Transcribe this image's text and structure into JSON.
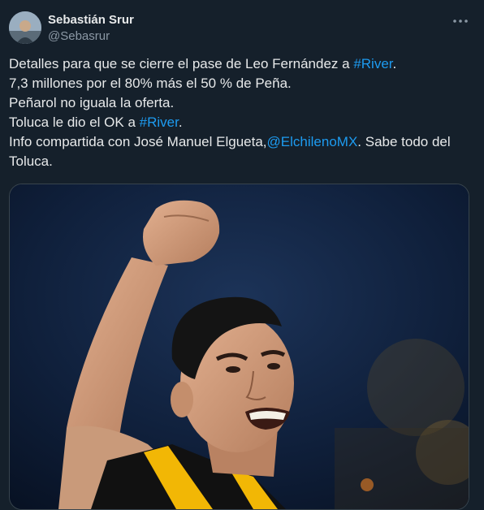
{
  "author": {
    "display_name": "Sebastián Srur",
    "handle": "@Sebasrur"
  },
  "icons": {
    "more": "more-dots-icon",
    "avatar": "avatar"
  },
  "tweet": {
    "line1_text": "Detalles para que se cierre el pase de Leo Fernández a ",
    "line1_hashtag": "#River",
    "line1_end": ".",
    "line2": "7,3 millones por el 80% más el 50 % de Peña.",
    "line3": "Peñarol no iguala la oferta.",
    "line4_text": "Toluca le dio el OK a ",
    "line4_hashtag": "#River",
    "line4_end": ".",
    "line5_text": "Info compartida con José Manuel Elgueta,",
    "line5_mention": "@ElchilenoMX",
    "line5_end": ". Sabe todo del",
    "line6": "Toluca."
  },
  "colors": {
    "background": "#15202b",
    "link": "#1d9bf0",
    "text": "#e7e9ea",
    "secondary": "#8b98a5",
    "jersey_yellow": "#f2b705"
  }
}
